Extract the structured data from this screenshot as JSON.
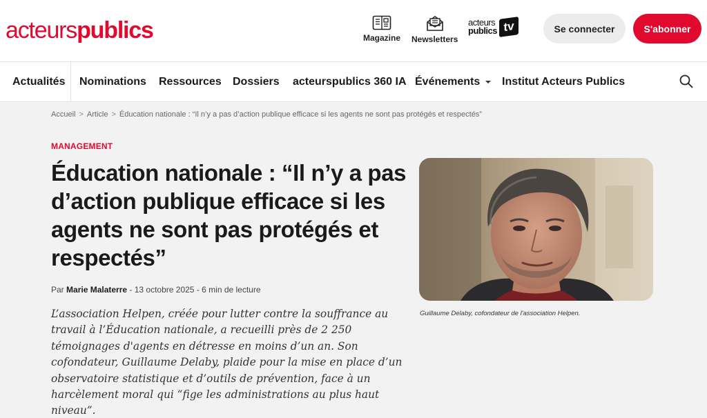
{
  "header": {
    "logo": {
      "part1": "acteurs",
      "part2": "publics"
    },
    "magazine_label": "Magazine",
    "newsletters_label": "Newsletters",
    "tv_logo": {
      "line1": "acteurs",
      "line2": "publics",
      "badge": "tv"
    },
    "connect_label": "Se connecter",
    "subscribe_label": "S'abonner"
  },
  "nav": {
    "items": [
      {
        "label": "Actualités"
      },
      {
        "label": "Nominations"
      },
      {
        "label": "Ressources"
      },
      {
        "label": "Dossiers"
      },
      {
        "label": "acteurspublics 360 IA"
      },
      {
        "label": "Événements"
      },
      {
        "label": "Institut Acteurs Publics"
      }
    ],
    "search_icon": "search-icon"
  },
  "breadcrumb": {
    "home": "Accueil",
    "section": "Article",
    "current": "Éducation nationale : “Il n’y a pas d’action publique efficace si les agents ne sont pas protégés et respectés”",
    "separator": ">"
  },
  "article": {
    "category": "MANAGEMENT",
    "title": "Éducation nationale : “Il n’y a pas d’action publique efficace si les agents ne sont pas protégés et respectés”",
    "byline_prefix": "Par",
    "author": "Marie Malaterre",
    "meta": " - 13 octobre 2025 - 6 min de lecture",
    "lead": "L’association Helpen, créée pour lutter contre la souffrance au travail à l’Éducation nationale, a recueilli près de 2 250 témoignages d'agents en détresse en moins d’un an. Son cofondateur, Guillaume Delaby, plaide pour la mise en place d’un observatoire statistique et d’outils de prévention, face à un harcèlement moral qui “fige les administrations au plus haut niveau”.",
    "photo_caption": "Guillaume Delaby, cofondateur de l'association Helpen."
  },
  "colors": {
    "brand_red": "#e10a2e",
    "page_bg": "#f2f2f2",
    "header_bg": "#ffffff"
  }
}
